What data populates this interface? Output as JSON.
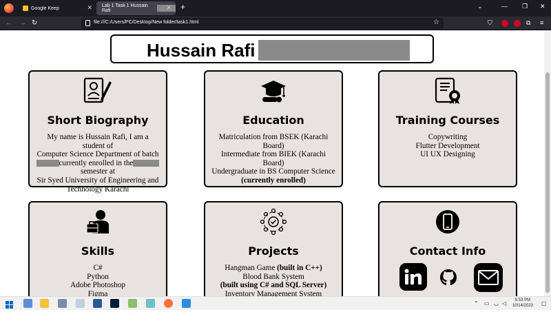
{
  "browser": {
    "tabs": [
      {
        "title": "Google Keep",
        "active": false
      },
      {
        "title": "Lab 1 Task 1 Hussain Rafi",
        "active": true
      }
    ],
    "url": "file:///C:/Users/PC/Desktop/New folder/task1.html"
  },
  "header": {
    "name": "Hussain Rafi"
  },
  "cards": {
    "biography": {
      "title": "Short Biography",
      "line1": "My name is Hussain Rafi, I am a student of",
      "line2": "Computer Science Department of batch",
      "line3_b": "currently enrolled in the",
      "line4": "semester at",
      "line5": "Sir Syed University of Engineering and",
      "line6": "Technology Karachi"
    },
    "education": {
      "title": "Education",
      "items": [
        "Matriculation from BSEK (Karachi Board)",
        "Intermediate from BIEK (Karachi Board)",
        "Undergraduate in BS Computer Science",
        "(currently enrolled)"
      ]
    },
    "training": {
      "title": "Training Courses",
      "items": [
        "Copywriting",
        "Flutter Development",
        "UI UX Designing"
      ]
    },
    "skills": {
      "title": "Skills",
      "items": [
        "C#",
        "Python",
        "Adobe Photoshop",
        "Figma"
      ]
    },
    "projects": {
      "title": "Projects",
      "p1_name": "Hangman Game ",
      "p1_note": "(built in C++)",
      "p2_name": "Blood Bank System",
      "p2_note": "(built using C# and SQL Server)",
      "p3_name": "Inventory Management System"
    },
    "contact": {
      "title": "Contact Info"
    }
  },
  "system": {
    "time": "5:53 PM",
    "date": "10/14/2023"
  }
}
